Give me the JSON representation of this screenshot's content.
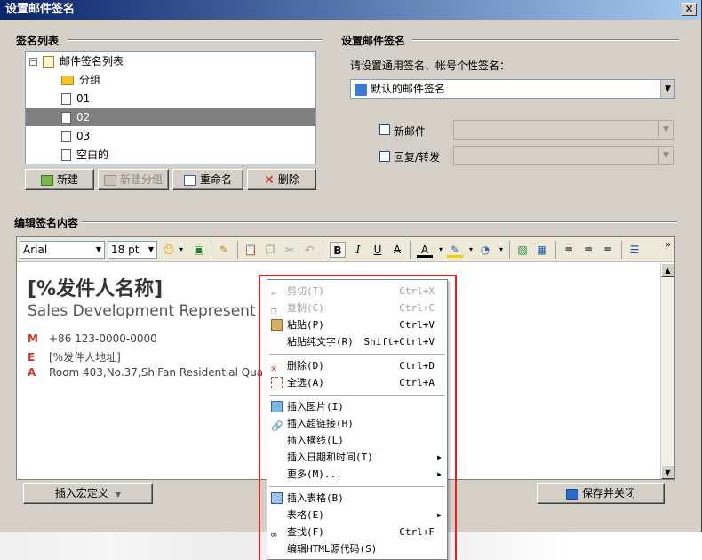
{
  "window": {
    "title": "设置邮件签名",
    "close_glyph": "✕"
  },
  "sig_list": {
    "section_title": "签名列表",
    "root_label": "邮件签名列表",
    "items": [
      {
        "label": "分组",
        "icon": "folder-icon"
      },
      {
        "label": "01",
        "icon": "document-icon"
      },
      {
        "label": "02",
        "icon": "document-icon",
        "selected": true
      },
      {
        "label": "03",
        "icon": "document-icon"
      },
      {
        "label": "空白的",
        "icon": "document-icon"
      }
    ],
    "buttons": {
      "new": "新建",
      "new_group": "新建分组",
      "rename": "重命名",
      "delete": "删除"
    }
  },
  "settings": {
    "section_title": "设置邮件签名",
    "prompt": "请设置通用签名、帐号个性签名：",
    "default_select": "默认的邮件签名",
    "new_mail_label": "新邮件",
    "reply_forward_label": "回复/转发"
  },
  "editor": {
    "section_title": "编辑签名内容",
    "font": "Arial",
    "size": "18 pt",
    "overflow_glyph": "»",
    "content": {
      "name": "[%发件人名称]",
      "title": "Sales Development Represent",
      "rows": [
        {
          "key": "M",
          "value": "+86 123-0000-0000"
        },
        {
          "key": "E",
          "value": "[%发件人地址]"
        },
        {
          "key": "A",
          "value": "Room 403,No.37,ShiFan Residential Qua"
        }
      ]
    }
  },
  "footer": {
    "macro_button": "插入宏定义",
    "save_button": "保存并关闭"
  },
  "context_menu": {
    "items": [
      {
        "label": "剪切(T)",
        "shortcut": "Ctrl+X",
        "disabled": true,
        "icon": "scissors-icon"
      },
      {
        "label": "复制(C)",
        "shortcut": "Ctrl+C",
        "disabled": true,
        "icon": "copy-icon"
      },
      {
        "label": "粘贴(P)",
        "shortcut": "Ctrl+V",
        "disabled": false,
        "icon": "paste-icon"
      },
      {
        "label": "粘贴纯文字(R)",
        "shortcut": "Shift+Ctrl+V",
        "disabled": false,
        "icon": ""
      },
      {
        "separator": true
      },
      {
        "label": "删除(D)",
        "shortcut": "Ctrl+D",
        "disabled": false,
        "icon": "delete-icon"
      },
      {
        "label": "全选(A)",
        "shortcut": "Ctrl+A",
        "disabled": false,
        "icon": "select-all-icon"
      },
      {
        "separator": true
      },
      {
        "label": "插入图片(I)",
        "shortcut": "",
        "disabled": false,
        "icon": "image-icon"
      },
      {
        "label": "插入超链接(H)",
        "shortcut": "",
        "disabled": false,
        "icon": "link-icon"
      },
      {
        "label": "插入横线(L)",
        "shortcut": "",
        "disabled": false,
        "icon": ""
      },
      {
        "label": "插入日期和时间(T)",
        "shortcut": "",
        "disabled": false,
        "icon": "",
        "submenu": true
      },
      {
        "label": "更多(M)...",
        "shortcut": "",
        "disabled": false,
        "icon": "",
        "submenu": true
      },
      {
        "separator": true
      },
      {
        "label": "插入表格(B)",
        "shortcut": "",
        "disabled": false,
        "icon": "table-icon"
      },
      {
        "label": "表格(E)",
        "shortcut": "",
        "disabled": false,
        "icon": "",
        "submenu": true
      },
      {
        "label": "查找(F)",
        "shortcut": "Ctrl+F",
        "disabled": false,
        "icon": "binoculars-icon"
      },
      {
        "label": "编辑HTML源代码(S)",
        "shortcut": "",
        "disabled": false,
        "icon": ""
      }
    ]
  },
  "colors": {
    "highlight": "#e4201e",
    "selection": "#808080",
    "accent_red": "#d9342b"
  }
}
